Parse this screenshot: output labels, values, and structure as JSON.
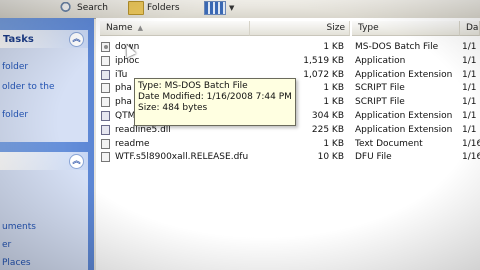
{
  "toolbar": {
    "search_label": "Search",
    "folders_label": "Folders"
  },
  "taskpane": {
    "tasks_header": "Tasks",
    "links": [
      "folder",
      "older to the",
      "folder"
    ],
    "bottom_links": [
      "uments",
      "er",
      "Places"
    ]
  },
  "columns": {
    "name": "Name",
    "size": "Size",
    "type": "Type",
    "date": "Da"
  },
  "files": [
    {
      "name": "down",
      "size": "1 KB",
      "type": "MS-DOS Batch File",
      "date": "1/1",
      "icon": "gear"
    },
    {
      "name": "iphoc",
      "size": "1,519 KB",
      "type": "Application",
      "date": "1/1",
      "icon": "app"
    },
    {
      "name": "iTu",
      "size": "1,072 KB",
      "type": "Application Extension",
      "date": "1/1",
      "icon": "dll"
    },
    {
      "name": "pha",
      "size": "1 KB",
      "type": "SCRIPT File",
      "date": "1/1",
      "icon": "file"
    },
    {
      "name": "pha",
      "size": "1 KB",
      "type": "SCRIPT File",
      "date": "1/1",
      "icon": "file"
    },
    {
      "name": "QTMLClient.dll",
      "size": "304 KB",
      "type": "Application Extension",
      "date": "1/1",
      "icon": "dll"
    },
    {
      "name": "readline5.dll",
      "size": "225 KB",
      "type": "Application Extension",
      "date": "1/1",
      "icon": "dll"
    },
    {
      "name": "readme",
      "size": "1 KB",
      "type": "Text Document",
      "date": "1/16/",
      "icon": "file"
    },
    {
      "name": "WTF.s5l8900xall.RELEASE.dfu",
      "size": "10 KB",
      "type": "DFU File",
      "date": "1/16/",
      "icon": "file"
    }
  ],
  "tooltip": {
    "type": "Type: MS-DOS Batch File",
    "date": "Date Modified: 1/16/2008 7:44 PM",
    "size": "Size: 484 bytes"
  }
}
